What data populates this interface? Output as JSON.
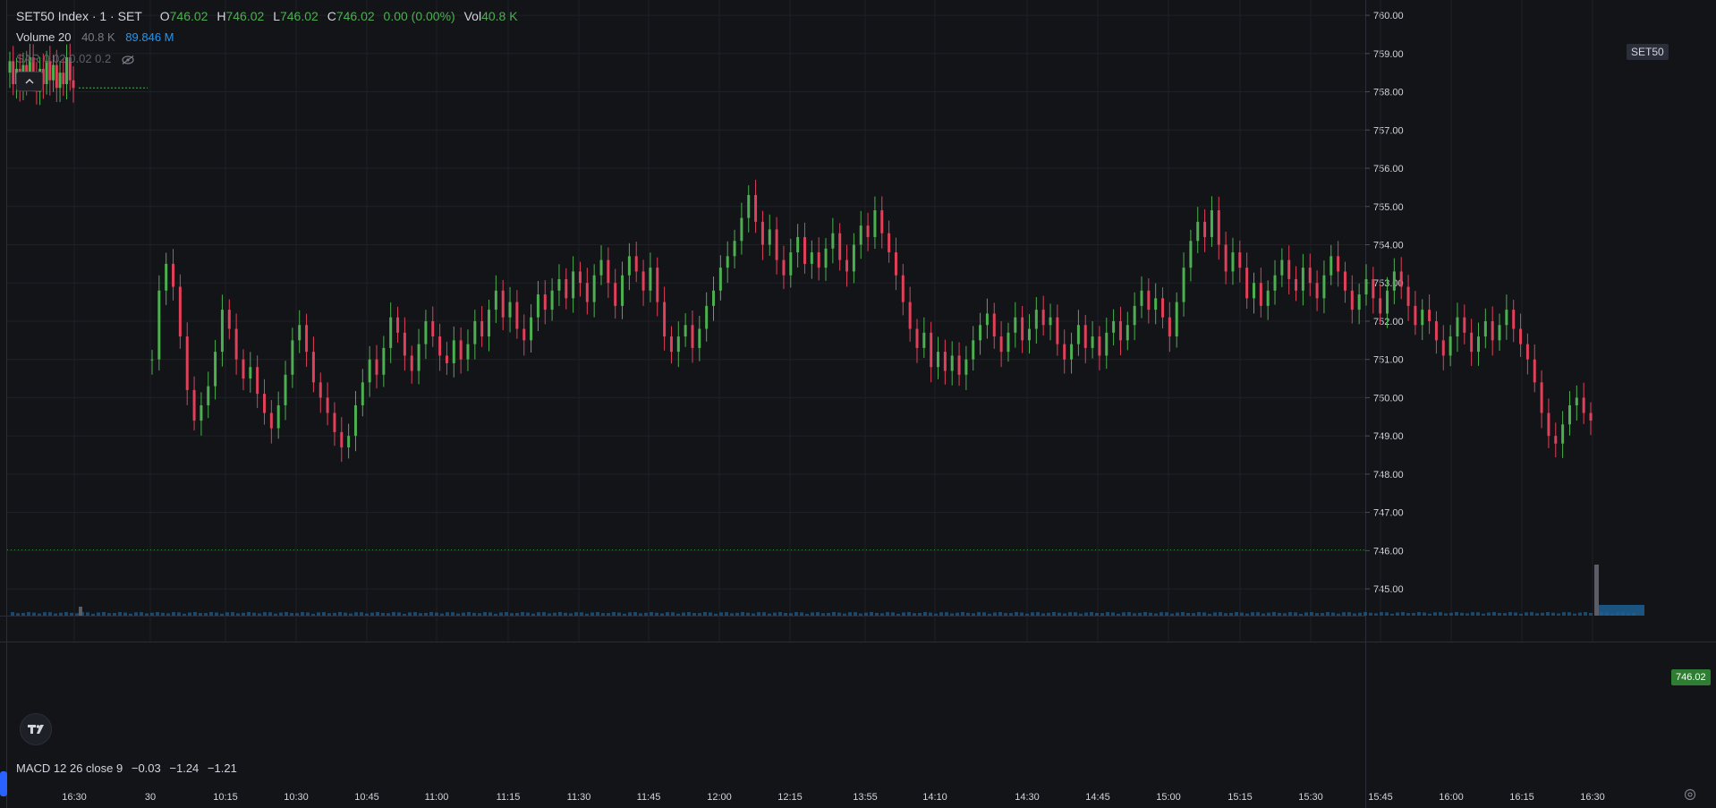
{
  "legend": {
    "title": "SET50 Index · 1 · SET",
    "o_label": "O",
    "o_value": "746.02",
    "h_label": "H",
    "h_value": "746.02",
    "l_label": "L",
    "l_value": "746.02",
    "c_label": "C",
    "c_value": "746.02",
    "change": "0.00 (0.00%)",
    "vol_label": "Vol",
    "vol_value": "40.8 K",
    "volume_title": "Volume 20",
    "volume_value": "40.8 K",
    "volume_ma": "89.846 M",
    "sar_title": "SAR 0.02 0.02 0.2"
  },
  "macd": {
    "title": "MACD 12 26 close 9",
    "v1": "−0.03",
    "v2": "−1.24",
    "v3": "−1.21"
  },
  "symbol_tag": "SET50",
  "price_tag": "746.02",
  "colors": {
    "background": "#131417",
    "up": "#4caf50",
    "down": "#e0405a",
    "grid": "#1e2128",
    "axis_text": "#d1d4dc",
    "volume": "#1e5f94"
  },
  "chart_data": {
    "type": "candlestick",
    "y_ticks": [
      "760.00",
      "759.00",
      "758.00",
      "757.00",
      "756.00",
      "755.00",
      "754.00",
      "753.00",
      "752.00",
      "751.00",
      "750.00",
      "749.00",
      "748.00",
      "747.00",
      "746.00",
      "745.00"
    ],
    "x_ticks": [
      "16:30",
      "30",
      "10:15",
      "10:30",
      "10:45",
      "11:00",
      "11:15",
      "11:30",
      "11:45",
      "12:00",
      "12:15",
      "13:55",
      "14:10",
      "14:30",
      "14:45",
      "15:00",
      "15:15",
      "15:30",
      "15:45",
      "16:00",
      "16:15",
      "16:30"
    ],
    "ylim": [
      744.3,
      760.4
    ],
    "last_price": 746.02,
    "series": [
      {
        "segment": "prev-session",
        "closes": [
          758.8,
          758.2,
          758.6,
          758.1,
          758.7,
          758.3,
          758.9,
          758.4,
          758.0,
          758.6,
          758.2,
          758.8,
          758.3,
          758.7,
          758.1,
          758.5,
          758.2,
          758.9,
          758.3,
          758.1
        ]
      },
      {
        "segment": "session",
        "closes": [
          751.0,
          752.8,
          753.5,
          752.9,
          751.6,
          750.2,
          749.4,
          749.8,
          750.3,
          751.2,
          752.3,
          751.8,
          751.0,
          750.5,
          750.8,
          750.1,
          749.6,
          749.2,
          749.8,
          750.6,
          751.5,
          751.9,
          751.2,
          750.4,
          750.0,
          749.6,
          749.1,
          748.7,
          749.0,
          749.8,
          750.4,
          751.0,
          750.6,
          751.3,
          752.1,
          751.7,
          751.1,
          750.7,
          751.4,
          752.0,
          751.6,
          751.1,
          750.9,
          751.5,
          751.0,
          751.4,
          752.0,
          751.6,
          752.3,
          752.8,
          752.1,
          752.5,
          751.8,
          751.5,
          752.1,
          752.7,
          752.3,
          752.8,
          753.1,
          752.6,
          753.3,
          753.0,
          752.5,
          753.2,
          753.6,
          753.0,
          752.4,
          753.2,
          753.7,
          753.3,
          752.8,
          753.4,
          752.5,
          751.6,
          751.2,
          751.6,
          751.9,
          751.3,
          751.8,
          752.4,
          752.8,
          753.4,
          753.7,
          754.1,
          754.7,
          755.3,
          754.6,
          754.0,
          754.4,
          753.6,
          753.2,
          753.8,
          754.2,
          753.5,
          753.8,
          753.4,
          753.9,
          754.3,
          753.6,
          753.3,
          754.0,
          754.5,
          754.2,
          754.9,
          754.3,
          753.8,
          753.2,
          752.5,
          751.8,
          751.3,
          751.7,
          750.8,
          751.2,
          750.7,
          751.1,
          750.6,
          751.0,
          751.5,
          751.9,
          752.2,
          751.6,
          751.2,
          751.7,
          752.1,
          751.5,
          751.8,
          752.3,
          751.9,
          752.1,
          751.4,
          751.0,
          751.4,
          751.9,
          751.3,
          751.6,
          751.1,
          751.7,
          752.0,
          751.5,
          751.9,
          752.4,
          752.8,
          752.3,
          752.6,
          752.1,
          751.6,
          752.5,
          753.4,
          754.1,
          754.6,
          754.2,
          754.9,
          754.0,
          753.3,
          753.8,
          753.4,
          752.6,
          753.0,
          752.4,
          752.8,
          753.2,
          753.6,
          753.1,
          752.8,
          753.4,
          753.0,
          752.6,
          753.2,
          753.7,
          753.3,
          752.8,
          752.3,
          752.7,
          753.1,
          752.6,
          752.2,
          752.8,
          753.3,
          752.9,
          752.4,
          751.9,
          752.3,
          752.0,
          751.5,
          751.1,
          751.6,
          752.1,
          751.7,
          751.2,
          751.6,
          752.0,
          751.5,
          751.9,
          752.3,
          751.8,
          751.4,
          751.0,
          750.4,
          749.6,
          749.0,
          748.8,
          749.3,
          749.8,
          750.0,
          749.6,
          749.4
        ]
      }
    ],
    "volume_spike_index": "last",
    "grid": true
  }
}
